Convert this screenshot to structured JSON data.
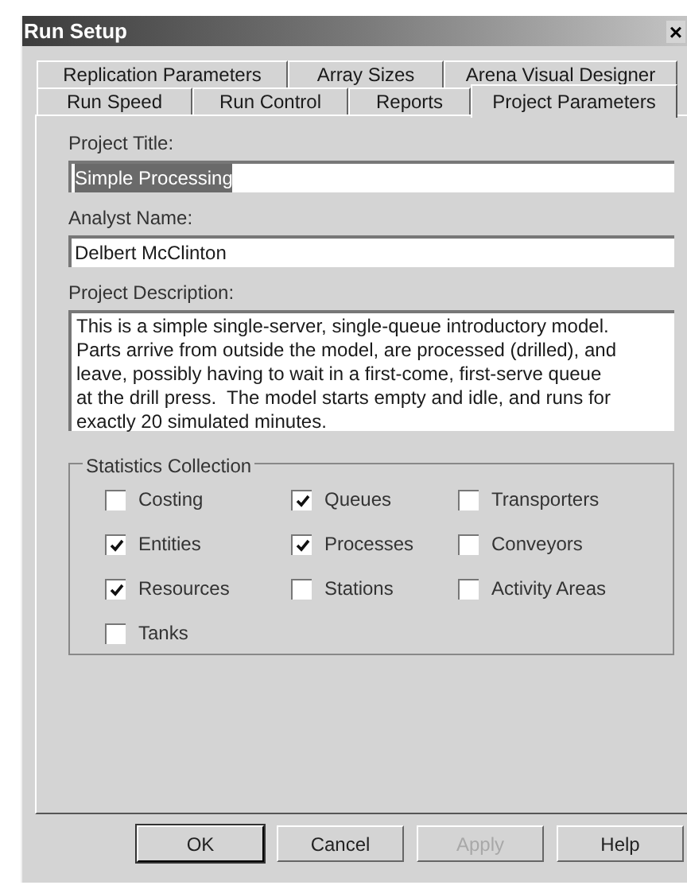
{
  "window": {
    "title": "Run Setup",
    "close": "×"
  },
  "tab_rows": [
    {
      "tabs": [
        {
          "label": "Replication Parameters",
          "selected": false
        },
        {
          "label": "Array Sizes",
          "selected": false
        },
        {
          "label": "Arena Visual Designer",
          "selected": false
        }
      ]
    },
    {
      "tabs": [
        {
          "label": "Run Speed",
          "selected": false
        },
        {
          "label": "Run Control",
          "selected": false
        },
        {
          "label": "Reports",
          "selected": false
        },
        {
          "label": "Project Parameters",
          "selected": true
        }
      ]
    }
  ],
  "fields": [
    {
      "label": "Project Title:",
      "value": "Simple Processing",
      "text_selected": true,
      "kind": "line"
    },
    {
      "label": "Analyst Name:",
      "value": "Delbert McClinton",
      "text_selected": false,
      "kind": "line"
    },
    {
      "label": "Project Description:",
      "value": "This is a simple single-server, single-queue introductory model.\nParts arrive from outside the model, are processed (drilled), and\nleave, possibly having to wait in a first-come, first-serve queue\nat the drill press.  The model starts empty and idle, and runs for\nexactly 20 simulated minutes.",
      "text_selected": false,
      "kind": "area"
    }
  ],
  "statistics_collection": {
    "title": "Statistics Collection",
    "options": [
      {
        "label": "Costing",
        "checked": false
      },
      {
        "label": "Queues",
        "checked": true
      },
      {
        "label": "Transporters",
        "checked": false
      },
      {
        "label": "Entities",
        "checked": true
      },
      {
        "label": "Processes",
        "checked": true
      },
      {
        "label": "Conveyors",
        "checked": false
      },
      {
        "label": "Resources",
        "checked": true
      },
      {
        "label": "Stations",
        "checked": false
      },
      {
        "label": "Activity Areas",
        "checked": false
      },
      {
        "label": "Tanks",
        "checked": false
      }
    ]
  },
  "buttons": [
    {
      "label": "OK",
      "default": true,
      "disabled": false
    },
    {
      "label": "Cancel",
      "default": false,
      "disabled": false
    },
    {
      "label": "Apply",
      "default": false,
      "disabled": true
    },
    {
      "label": "Help",
      "default": false,
      "disabled": false
    }
  ]
}
